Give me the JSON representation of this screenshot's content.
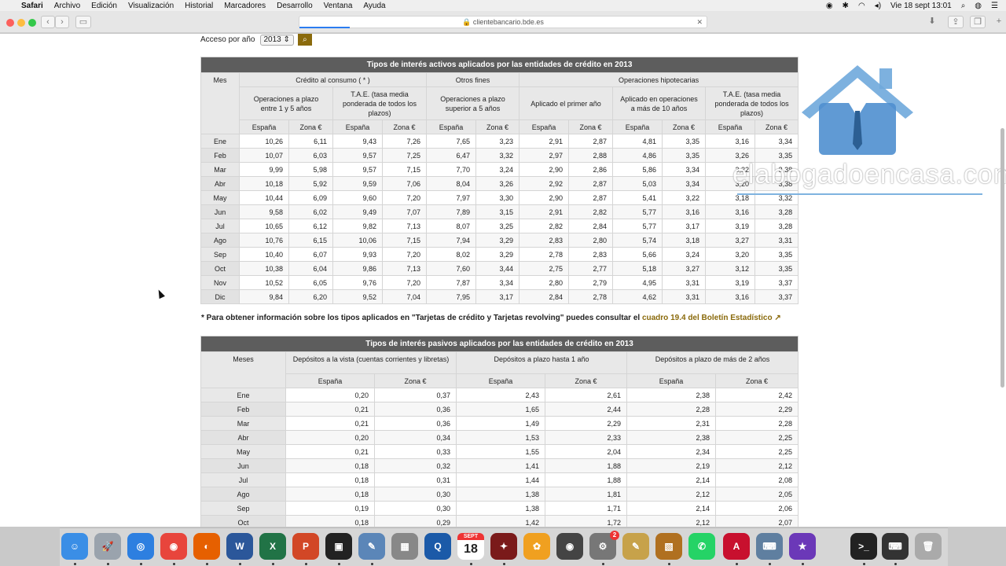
{
  "menubar": {
    "app": "Safari",
    "items": [
      "Archivo",
      "Edición",
      "Visualización",
      "Historial",
      "Marcadores",
      "Desarrollo",
      "Ventana",
      "Ayuda"
    ],
    "clock": "Vie 18 sept  13:01"
  },
  "browser": {
    "url": "clientebancario.bde.es"
  },
  "access": {
    "label": "Acceso por año",
    "year": "2013"
  },
  "table1": {
    "title": "Tipos de interés activos aplicados por las entidades de crédito en 2013",
    "mes_header": "Mes",
    "groups": [
      "Crédito al consumo ( * )",
      "Otros fines",
      "Operaciones hipotecarias"
    ],
    "subgroups": [
      "Operaciones a plazo entre 1 y 5 años",
      "T.A.E. (tasa media ponderada de todos los plazos)",
      "Operaciones a plazo superior a 5 años",
      "Aplicado el primer año",
      "Aplicado en operaciones a más de 10 años",
      "T.A.E. (tasa media ponderada de todos los plazos)"
    ],
    "cols": [
      "España",
      "Zona €",
      "España",
      "Zona €",
      "España",
      "Zona €",
      "España",
      "Zona €",
      "España",
      "Zona €",
      "España",
      "Zona €"
    ],
    "rows": [
      [
        "Ene",
        "10,26",
        "6,11",
        "9,43",
        "7,26",
        "7,65",
        "3,23",
        "2,91",
        "2,87",
        "4,81",
        "3,35",
        "3,16",
        "3,34"
      ],
      [
        "Feb",
        "10,07",
        "6,03",
        "9,57",
        "7,25",
        "6,47",
        "3,32",
        "2,97",
        "2,88",
        "4,86",
        "3,35",
        "3,26",
        "3,35"
      ],
      [
        "Mar",
        "9,99",
        "5,98",
        "9,57",
        "7,15",
        "7,70",
        "3,24",
        "2,90",
        "2,86",
        "5,86",
        "3,34",
        "3,22",
        "3,38"
      ],
      [
        "Abr",
        "10,18",
        "5,92",
        "9,59",
        "7,06",
        "8,04",
        "3,26",
        "2,92",
        "2,87",
        "5,03",
        "3,34",
        "3,20",
        "3,38"
      ],
      [
        "May",
        "10,44",
        "6,09",
        "9,60",
        "7,20",
        "7,97",
        "3,30",
        "2,90",
        "2,87",
        "5,41",
        "3,22",
        "3,18",
        "3,32"
      ],
      [
        "Jun",
        "9,58",
        "6,02",
        "9,49",
        "7,07",
        "7,89",
        "3,15",
        "2,91",
        "2,82",
        "5,77",
        "3,16",
        "3,16",
        "3,28"
      ],
      [
        "Jul",
        "10,65",
        "6,12",
        "9,82",
        "7,13",
        "8,07",
        "3,25",
        "2,82",
        "2,84",
        "5,77",
        "3,17",
        "3,19",
        "3,28"
      ],
      [
        "Ago",
        "10,76",
        "6,15",
        "10,06",
        "7,15",
        "7,94",
        "3,29",
        "2,83",
        "2,80",
        "5,74",
        "3,18",
        "3,27",
        "3,31"
      ],
      [
        "Sep",
        "10,40",
        "6,07",
        "9,93",
        "7,20",
        "8,02",
        "3,29",
        "2,78",
        "2,83",
        "5,66",
        "3,24",
        "3,20",
        "3,35"
      ],
      [
        "Oct",
        "10,38",
        "6,04",
        "9,86",
        "7,13",
        "7,60",
        "3,44",
        "2,75",
        "2,77",
        "5,18",
        "3,27",
        "3,12",
        "3,35"
      ],
      [
        "Nov",
        "10,52",
        "6,05",
        "9,76",
        "7,20",
        "7,87",
        "3,34",
        "2,80",
        "2,79",
        "4,95",
        "3,31",
        "3,19",
        "3,37"
      ],
      [
        "Dic",
        "9,84",
        "6,20",
        "9,52",
        "7,04",
        "7,95",
        "3,17",
        "2,84",
        "2,78",
        "4,62",
        "3,31",
        "3,16",
        "3,37"
      ]
    ]
  },
  "note": {
    "text": "* Para obtener información sobre los tipos aplicados en \"Tarjetas de crédito y Tarjetas revolving\" puedes consultar el ",
    "link": "cuadro 19.4 del Boletín Estadístico"
  },
  "table2": {
    "title": "Tipos de interés pasivos aplicados por las entidades de crédito en 2013",
    "mes_header": "Meses",
    "groups": [
      "Depósitos a la vista (cuentas corrientes y libretas)",
      "Depósitos a plazo hasta 1 año",
      "Depósitos a plazo de más de 2 años"
    ],
    "cols": [
      "España",
      "Zona €",
      "España",
      "Zona €",
      "España",
      "Zona €"
    ],
    "rows": [
      [
        "Ene",
        "0,20",
        "0,37",
        "2,43",
        "2,61",
        "2,38",
        "2,42"
      ],
      [
        "Feb",
        "0,21",
        "0,36",
        "1,65",
        "2,44",
        "2,28",
        "2,29"
      ],
      [
        "Mar",
        "0,21",
        "0,36",
        "1,49",
        "2,29",
        "2,31",
        "2,28"
      ],
      [
        "Abr",
        "0,20",
        "0,34",
        "1,53",
        "2,33",
        "2,38",
        "2,25"
      ],
      [
        "May",
        "0,21",
        "0,33",
        "1,55",
        "2,04",
        "2,34",
        "2,25"
      ],
      [
        "Jun",
        "0,18",
        "0,32",
        "1,41",
        "1,88",
        "2,19",
        "2,12"
      ],
      [
        "Jul",
        "0,18",
        "0,31",
        "1,44",
        "1,88",
        "2,14",
        "2,08"
      ],
      [
        "Ago",
        "0,18",
        "0,30",
        "1,38",
        "1,81",
        "2,12",
        "2,05"
      ],
      [
        "Sep",
        "0,19",
        "0,30",
        "1,38",
        "1,71",
        "2,14",
        "2,06"
      ],
      [
        "Oct",
        "0,18",
        "0,29",
        "1,42",
        "1,72",
        "2,12",
        "2,07"
      ]
    ]
  },
  "watermark": "elabogadoencasa.com",
  "dock": {
    "date_icon": "18",
    "date_month": "SEPT",
    "badge": "2",
    "apps": [
      {
        "name": "finder-icon",
        "glyph": "☺",
        "color": "#3a8ee6"
      },
      {
        "name": "launchpad-icon",
        "glyph": "🚀",
        "color": "#9aa3ad"
      },
      {
        "name": "safari-icon",
        "glyph": "◎",
        "color": "#2d7fe0"
      },
      {
        "name": "chrome-icon",
        "glyph": "◉",
        "color": "#e8453c"
      },
      {
        "name": "firefox-icon",
        "glyph": "◐",
        "color": "#e66000"
      },
      {
        "name": "word-icon",
        "glyph": "W",
        "color": "#2b579a"
      },
      {
        "name": "excel-icon",
        "glyph": "X",
        "color": "#217346"
      },
      {
        "name": "powerpoint-icon",
        "glyph": "P",
        "color": "#d24726"
      },
      {
        "name": "photo-booth-icon",
        "glyph": "▣",
        "color": "#222"
      },
      {
        "name": "preview-icon",
        "glyph": "✎",
        "color": "#5b86b8"
      },
      {
        "name": "calculator-icon",
        "glyph": "▦",
        "color": "#888"
      },
      {
        "name": "quicktime-icon",
        "glyph": "Q",
        "color": "#1b5aa8"
      },
      {
        "name": "calendar-icon",
        "glyph": "",
        "color": "#fff"
      },
      {
        "name": "photo-booth-2-icon",
        "glyph": "✦",
        "color": "#7a1a1a"
      },
      {
        "name": "photos-icon",
        "glyph": "✿",
        "color": "#f0a020"
      },
      {
        "name": "screenshot-icon",
        "glyph": "◉",
        "color": "#444"
      },
      {
        "name": "system-preferences-icon",
        "glyph": "⚙",
        "color": "#777"
      },
      {
        "name": "textedit-icon",
        "glyph": "✎",
        "color": "#c7a24a"
      },
      {
        "name": "image-capture-icon",
        "glyph": "▧",
        "color": "#b07020"
      },
      {
        "name": "whatsapp-icon",
        "glyph": "✆",
        "color": "#25d366"
      },
      {
        "name": "acrobat-icon",
        "glyph": "A",
        "color": "#c8102e"
      },
      {
        "name": "network-icon",
        "glyph": "⌨",
        "color": "#5f7fa0"
      },
      {
        "name": "imovie-icon",
        "glyph": "★",
        "color": "#6b38b8"
      },
      {
        "name": "terminal-icon",
        "glyph": ">_",
        "color": "#222"
      },
      {
        "name": "keyboard-icon",
        "glyph": "⌨",
        "color": "#333"
      },
      {
        "name": "trash-icon",
        "glyph": "🗑",
        "color": "#aaa"
      }
    ]
  }
}
